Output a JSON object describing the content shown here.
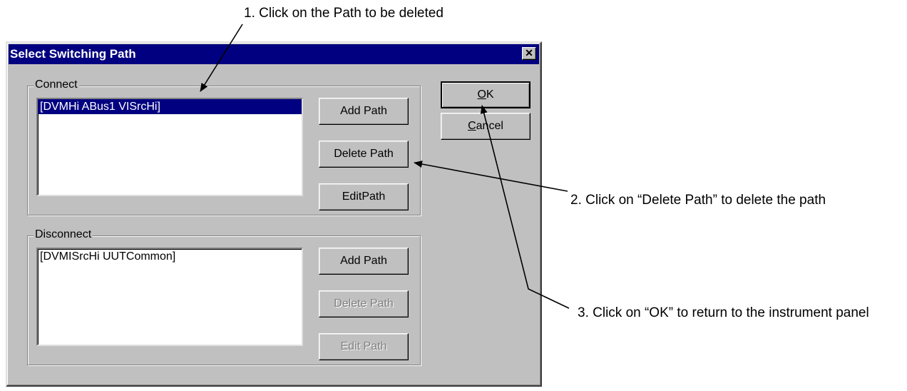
{
  "annotations": {
    "step1": "1. Click on the Path to be deleted",
    "step2": "2. Click on “Delete Path” to delete the path",
    "step3": "3. Click on “OK” to return to the instrument panel"
  },
  "dialog": {
    "title": "Select Switching Path",
    "close_glyph": "✕",
    "ok_label_first": "O",
    "ok_label_rest": "K",
    "cancel_label_first": "C",
    "cancel_label_mid": "a",
    "cancel_label_rest": "ncel",
    "connect": {
      "label": "Connect",
      "items": [
        "[DVMHi ABus1 VISrcHi]"
      ],
      "selected_index": 0,
      "add_label": "Add Path",
      "delete_label": "Delete Path",
      "edit_label": "EditPath"
    },
    "disconnect": {
      "label": "Disconnect",
      "items": [
        "[DVMISrcHi UUTCommon]"
      ],
      "add_label": "Add Path",
      "delete_label": "Delete Path",
      "edit_label": "Edit Path"
    }
  },
  "colors": {
    "title_bar": "#000080",
    "dialog_face": "#c0c0c0",
    "selection": "#000080"
  }
}
